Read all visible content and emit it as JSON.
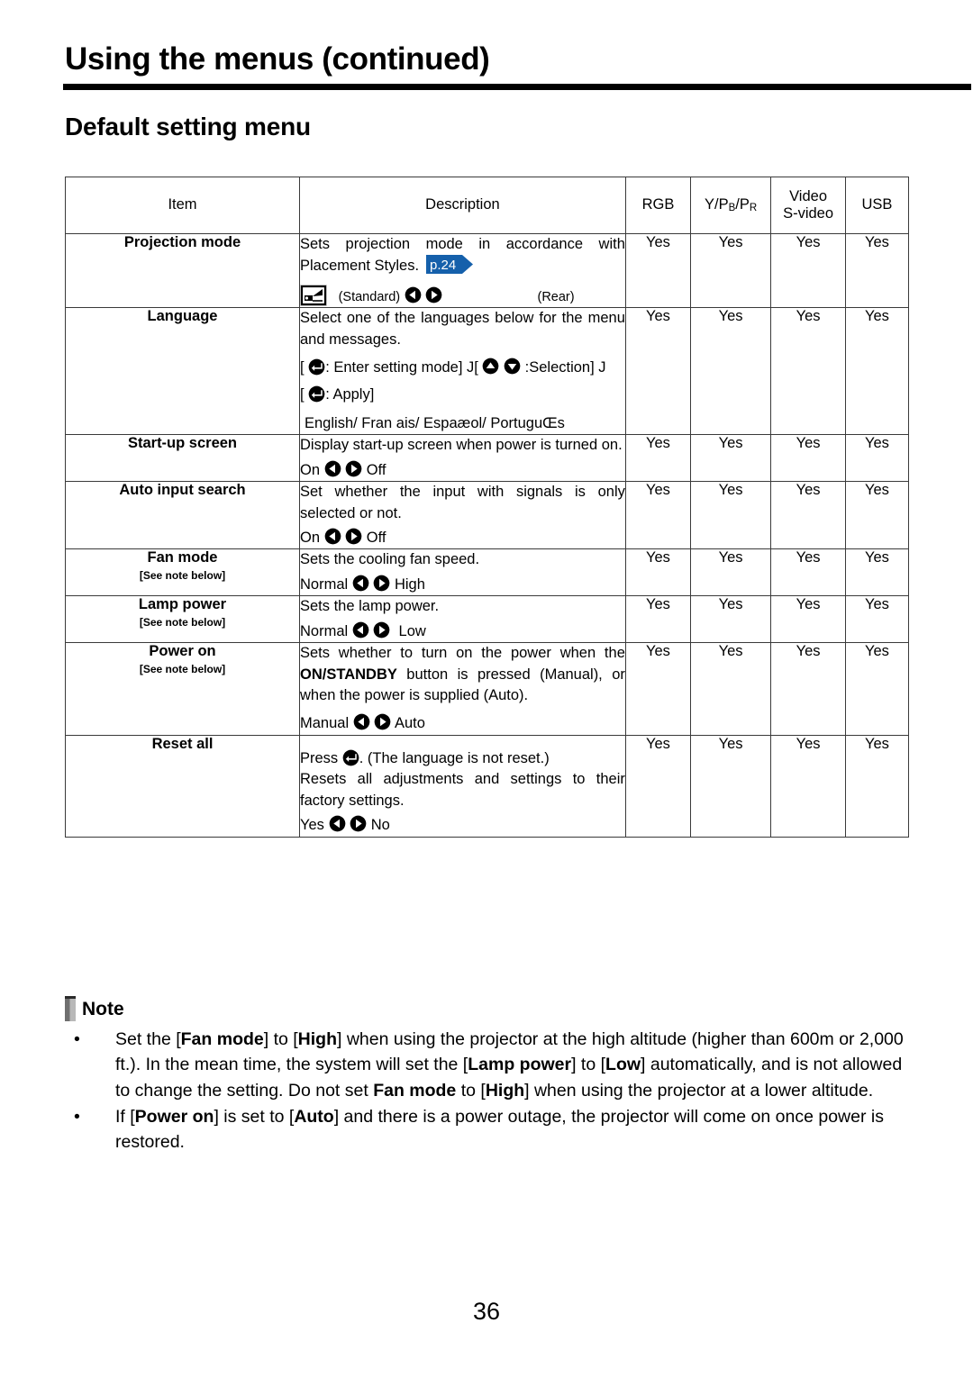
{
  "header": {
    "title": "Using the menus (continued)",
    "section_title": "Default setting menu"
  },
  "table": {
    "columns": [
      {
        "key": "item",
        "label": "Item"
      },
      {
        "key": "desc",
        "label": "Description"
      },
      {
        "key": "rgb",
        "label": "RGB"
      },
      {
        "key": "ypbpr",
        "label": "Y/P",
        "sub1": "B",
        "mid": "/P",
        "sub2": "R"
      },
      {
        "key": "video",
        "label_line1": "Video",
        "label_line2": "S-video"
      },
      {
        "key": "usb",
        "label": "USB"
      }
    ],
    "rows": [
      {
        "item": "Projection mode",
        "item_note": "",
        "desc_line1": "Sets projection mode in accordance with",
        "desc_line2": "Placement Styles.",
        "page_ref": "p.24",
        "option_left": "(Standard)",
        "option_right": "(Rear)",
        "has_projector_icon": true,
        "rgb": "Yes",
        "ypbpr": "Yes",
        "video": "Yes",
        "usb": "Yes"
      },
      {
        "item": "Language",
        "item_note": "",
        "desc_line1": "Select one of the languages below for the menu",
        "desc_line2": "and messages.",
        "key_line_a_pre": "[",
        "key_line_a_mid": ": Enter setting mode]  J[",
        "key_line_a_post": ":Selection] J",
        "key_line_b_pre": "[",
        "key_line_b_post": ": Apply]",
        "languages": "English/ Fran ais/ Espaæol/ PortuguŒs",
        "rgb": "Yes",
        "ypbpr": "Yes",
        "video": "Yes",
        "usb": "Yes"
      },
      {
        "item": "Start-up screen",
        "item_note": "",
        "desc_line1": "Display start-up screen when power is turned on.",
        "option_left": "On",
        "option_right": "Off",
        "rgb": "Yes",
        "ypbpr": "Yes",
        "video": "Yes",
        "usb": "Yes"
      },
      {
        "item": "Auto input search",
        "item_note": "",
        "desc_line1": "Set whether the input with signals is only",
        "desc_line2": "selected or not.",
        "option_left": "On",
        "option_right": "Off",
        "rgb": "Yes",
        "ypbpr": "Yes",
        "video": "Yes",
        "usb": "Yes"
      },
      {
        "item": "Fan mode",
        "item_note": "[See note below]",
        "desc_line1": "Sets the cooling fan speed.",
        "option_left": "Normal",
        "option_right": "High",
        "rgb": "Yes",
        "ypbpr": "Yes",
        "video": "Yes",
        "usb": "Yes"
      },
      {
        "item": "Lamp power",
        "item_note": "[See note below]",
        "desc_line1": "Sets the lamp power.",
        "option_left": "Normal",
        "option_right": "Low",
        "rgb": "Yes",
        "ypbpr": "Yes",
        "video": "Yes",
        "usb": "Yes"
      },
      {
        "item": "Power on",
        "item_note": "[See note below]",
        "desc_p1": "Sets whether to turn on the power when the ",
        "desc_b1": "ON/",
        "desc_b2": "STANDBY",
        "desc_p2": " button is pressed (Manual), or when the power is supplied (Auto).",
        "option_left": "Manual",
        "option_right": "Auto",
        "rgb": "Yes",
        "ypbpr": "Yes",
        "video": "Yes",
        "usb": "Yes"
      },
      {
        "item": "Reset all",
        "item_note": "",
        "desc_press_pre": "Press ",
        "desc_press_post": ". (The language is not reset.)",
        "desc_line2": "Resets all adjustments and settings to their",
        "desc_line3": "factory settings.",
        "option_left": "Yes",
        "option_right": "No",
        "rgb": "Yes",
        "ypbpr": "Yes",
        "video": "Yes",
        "usb": "Yes"
      }
    ]
  },
  "note": {
    "label": "Note",
    "bullet": "•",
    "items": [
      {
        "seg1": "Set the [",
        "bold1": "Fan mode",
        "seg2": "] to [",
        "bold2": "High",
        "seg3": "] when using the projector at the high altitude (higher than 600m or 2,000 ft.). In the mean time, the system will set the [",
        "bold3": "Lamp power",
        "seg4": "] to [",
        "bold4": "Low",
        "seg5": "] automatically, and is not allowed to change the setting. Do not set ",
        "bold5": "Fan mode",
        "seg6": " to [",
        "bold6": "High",
        "seg7": "] when using the projector at a lower altitude."
      },
      {
        "seg1": "If  [",
        "bold1": "Power on",
        "seg2": "] is set to [",
        "bold2": "Auto",
        "seg3": "] and there is a power outage, the projector will come on once power is restored.",
        "bold3": "",
        "seg4": "",
        "bold4": "",
        "seg5": "",
        "bold5": "",
        "seg6": "",
        "bold6": "",
        "seg7": ""
      }
    ]
  },
  "footer": {
    "page_number": "36"
  },
  "colors": {
    "page_ref_blue": "#1560ab",
    "table_border": "#3a3a3a",
    "text": "#000000"
  },
  "icons": {
    "arrow_left": "arrow-left-circle-icon",
    "arrow_right": "arrow-right-circle-icon",
    "arrow_up": "arrow-up-circle-icon",
    "arrow_down": "arrow-down-circle-icon",
    "enter": "enter-key-icon",
    "projector": "projector-standard-icon",
    "note_flag": "note-flag-icon"
  }
}
